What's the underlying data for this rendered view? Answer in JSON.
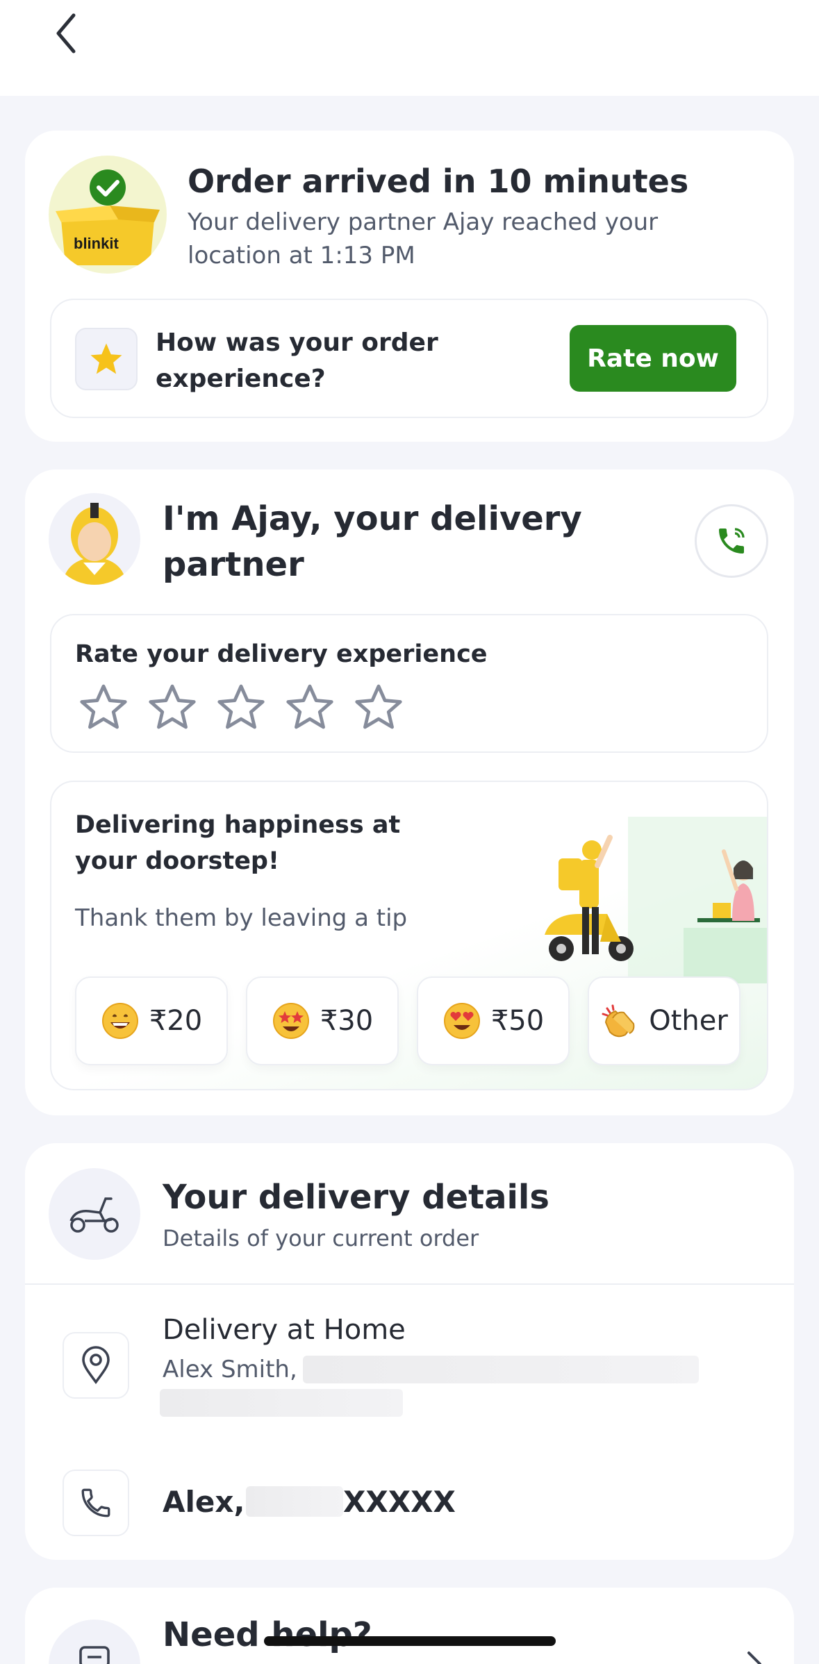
{
  "header": {
    "back_icon": "chevron-left-icon"
  },
  "order_card": {
    "title": "Order arrived in 10 minutes",
    "subtitle": "Your delivery partner Ajay reached your location at 1:13 PM",
    "logo_text": "blinkit",
    "rating_prompt": "How was your order experience?",
    "rate_button": "Rate now",
    "accent_color": "#2a8a1f"
  },
  "partner_card": {
    "title": "I'm Ajay, your delivery partner",
    "rate_label": "Rate your delivery experience",
    "stars": [
      {
        "name": "star-1"
      },
      {
        "name": "star-2"
      },
      {
        "name": "star-3"
      },
      {
        "name": "star-4"
      },
      {
        "name": "star-5"
      }
    ],
    "tip_heading": "Delivering happiness at your doorstep!",
    "tip_sub": "Thank them by leaving a tip",
    "tips": [
      {
        "label": "₹20",
        "emoji": "grin-face-icon"
      },
      {
        "label": "₹30",
        "emoji": "star-struck-face-icon"
      },
      {
        "label": "₹50",
        "emoji": "heart-eyes-face-icon"
      },
      {
        "label": "Other",
        "emoji": "clapping-hands-icon"
      }
    ]
  },
  "delivery_card": {
    "title": "Your delivery details",
    "subtitle": "Details of your current order",
    "address_title": "Delivery at Home",
    "address_name": "Alex Smith,",
    "phone_name": "Alex,",
    "phone_masked": "XXXXX"
  },
  "help_card": {
    "title": "Need help?"
  }
}
